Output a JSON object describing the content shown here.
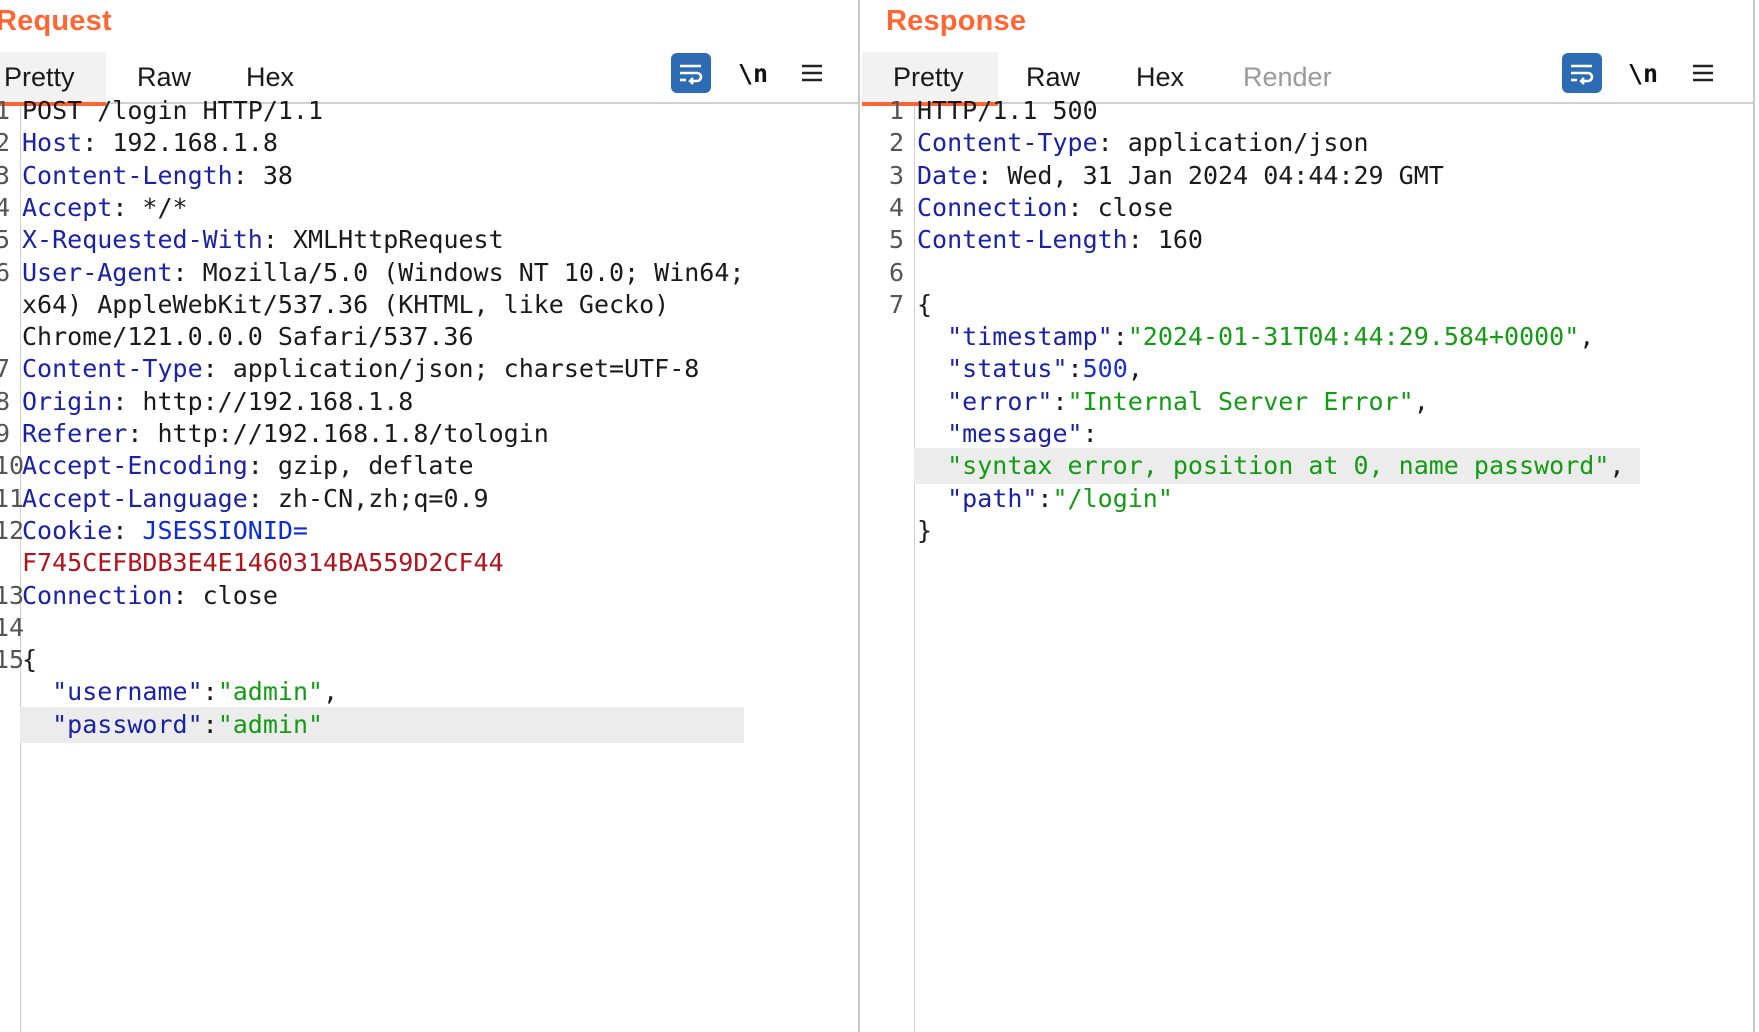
{
  "request": {
    "title": "Request",
    "tabs": [
      {
        "label": "Pretty",
        "active": true
      },
      {
        "label": "Raw",
        "active": false
      },
      {
        "label": "Hex",
        "active": false
      }
    ],
    "toolbar": {
      "wrap_icon": "word-wrap-icon",
      "newline_label": "\\n",
      "menu_icon": "hamburger-menu-icon"
    },
    "lines": [
      {
        "n": "1",
        "parts": [
          {
            "t": "POST /login HTTP/1.1",
            "c": "pl"
          }
        ]
      },
      {
        "n": "2",
        "parts": [
          {
            "t": "Host",
            "c": "hk"
          },
          {
            "t": ": 192.168.1.8",
            "c": "pl"
          }
        ]
      },
      {
        "n": "3",
        "parts": [
          {
            "t": "Content-Length",
            "c": "hk"
          },
          {
            "t": ": 38",
            "c": "pl"
          }
        ]
      },
      {
        "n": "4",
        "parts": [
          {
            "t": "Accept",
            "c": "hk"
          },
          {
            "t": ": */*",
            "c": "pl"
          }
        ]
      },
      {
        "n": "5",
        "parts": [
          {
            "t": "X-Requested-With",
            "c": "hk"
          },
          {
            "t": ": XMLHttpRequest",
            "c": "pl"
          }
        ]
      },
      {
        "n": "6",
        "parts": [
          {
            "t": "User-Agent",
            "c": "hk"
          },
          {
            "t": ": Mozilla/5.0 (Windows NT 10.0; Win64;",
            "c": "pl"
          }
        ]
      },
      {
        "n": "",
        "parts": [
          {
            "t": "x64) AppleWebKit/537.36 (KHTML, like Gecko)",
            "c": "pl"
          }
        ]
      },
      {
        "n": "",
        "parts": [
          {
            "t": "Chrome/121.0.0.0 Safari/537.36",
            "c": "pl"
          }
        ]
      },
      {
        "n": "7",
        "parts": [
          {
            "t": "Content-Type",
            "c": "hk"
          },
          {
            "t": ": application/json; charset=UTF-8",
            "c": "pl"
          }
        ]
      },
      {
        "n": "8",
        "parts": [
          {
            "t": "Origin",
            "c": "hk"
          },
          {
            "t": ": http://192.168.1.8",
            "c": "pl"
          }
        ]
      },
      {
        "n": "9",
        "parts": [
          {
            "t": "Referer",
            "c": "hk"
          },
          {
            "t": ": http://192.168.1.8/tologin",
            "c": "pl"
          }
        ]
      },
      {
        "n": "10",
        "parts": [
          {
            "t": "Accept-Encoding",
            "c": "hk"
          },
          {
            "t": ": gzip, deflate",
            "c": "pl"
          }
        ]
      },
      {
        "n": "11",
        "parts": [
          {
            "t": "Accept-Language",
            "c": "hk"
          },
          {
            "t": ": zh-CN,zh;q=0.9",
            "c": "pl"
          }
        ]
      },
      {
        "n": "12",
        "parts": [
          {
            "t": "Cookie",
            "c": "hk"
          },
          {
            "t": ": ",
            "c": "pl"
          },
          {
            "t": "JSESSIONID=",
            "c": "ck"
          }
        ]
      },
      {
        "n": "",
        "parts": [
          {
            "t": "F745CEFBDB3E4E1460314BA559D2CF44",
            "c": "cv"
          }
        ]
      },
      {
        "n": "13",
        "parts": [
          {
            "t": "Connection",
            "c": "hk"
          },
          {
            "t": ": close",
            "c": "pl"
          }
        ]
      },
      {
        "n": "14",
        "parts": []
      },
      {
        "n": "15",
        "parts": [
          {
            "t": "{",
            "c": "pl"
          }
        ]
      },
      {
        "n": "",
        "parts": [
          {
            "t": "  ",
            "c": "pl"
          },
          {
            "t": "\"username\"",
            "c": "key"
          },
          {
            "t": ":",
            "c": "pl"
          },
          {
            "t": "\"admin\"",
            "c": "str"
          },
          {
            "t": ",",
            "c": "pl"
          }
        ]
      },
      {
        "n": "",
        "highlight": true,
        "parts": [
          {
            "t": "  ",
            "c": "pl"
          },
          {
            "t": "\"password\"",
            "c": "key"
          },
          {
            "t": ":",
            "c": "pl"
          },
          {
            "t": "\"admin\"",
            "c": "str"
          }
        ]
      }
    ]
  },
  "response": {
    "title": "Response",
    "tabs": [
      {
        "label": "Pretty",
        "active": true
      },
      {
        "label": "Raw",
        "active": false
      },
      {
        "label": "Hex",
        "active": false
      },
      {
        "label": "Render",
        "active": false,
        "disabled": true
      }
    ],
    "toolbar": {
      "wrap_icon": "word-wrap-icon",
      "newline_label": "\\n",
      "menu_icon": "hamburger-menu-icon"
    },
    "lines": [
      {
        "n": "1",
        "parts": [
          {
            "t": "HTTP/1.1 500",
            "c": "pl"
          }
        ]
      },
      {
        "n": "2",
        "parts": [
          {
            "t": "Content-Type",
            "c": "hk"
          },
          {
            "t": ": application/json",
            "c": "pl"
          }
        ]
      },
      {
        "n": "3",
        "parts": [
          {
            "t": "Date",
            "c": "hk"
          },
          {
            "t": ": Wed, 31 Jan 2024 04:44:29 GMT",
            "c": "pl"
          }
        ]
      },
      {
        "n": "4",
        "parts": [
          {
            "t": "Connection",
            "c": "hk"
          },
          {
            "t": ": close",
            "c": "pl"
          }
        ]
      },
      {
        "n": "5",
        "parts": [
          {
            "t": "Content-Length",
            "c": "hk"
          },
          {
            "t": ": 160",
            "c": "pl"
          }
        ]
      },
      {
        "n": "6",
        "parts": []
      },
      {
        "n": "7",
        "parts": [
          {
            "t": "{",
            "c": "pl"
          }
        ]
      },
      {
        "n": "",
        "parts": [
          {
            "t": "  ",
            "c": "pl"
          },
          {
            "t": "\"timestamp\"",
            "c": "key"
          },
          {
            "t": ":",
            "c": "pl"
          },
          {
            "t": "\"2024-01-31T04:44:29.584+0000\"",
            "c": "str"
          },
          {
            "t": ",",
            "c": "pl"
          }
        ]
      },
      {
        "n": "",
        "parts": [
          {
            "t": "  ",
            "c": "pl"
          },
          {
            "t": "\"status\"",
            "c": "key"
          },
          {
            "t": ":",
            "c": "pl"
          },
          {
            "t": "500",
            "c": "num"
          },
          {
            "t": ",",
            "c": "pl"
          }
        ]
      },
      {
        "n": "",
        "parts": [
          {
            "t": "  ",
            "c": "pl"
          },
          {
            "t": "\"error\"",
            "c": "key"
          },
          {
            "t": ":",
            "c": "pl"
          },
          {
            "t": "\"Internal Server Error\"",
            "c": "str"
          },
          {
            "t": ",",
            "c": "pl"
          }
        ]
      },
      {
        "n": "",
        "parts": [
          {
            "t": "  ",
            "c": "pl"
          },
          {
            "t": "\"message\"",
            "c": "key"
          },
          {
            "t": ":",
            "c": "pl"
          }
        ]
      },
      {
        "n": "",
        "highlight": true,
        "parts": [
          {
            "t": "  ",
            "c": "pl"
          },
          {
            "t": "\"syntax error, position at 0, name password\"",
            "c": "str"
          },
          {
            "t": ",",
            "c": "pl"
          }
        ]
      },
      {
        "n": "",
        "parts": [
          {
            "t": "  ",
            "c": "pl"
          },
          {
            "t": "\"path\"",
            "c": "key"
          },
          {
            "t": ":",
            "c": "pl"
          },
          {
            "t": "\"/login\"",
            "c": "str"
          }
        ]
      },
      {
        "n": "",
        "parts": [
          {
            "t": "}",
            "c": "pl"
          }
        ]
      }
    ]
  },
  "layout_switch": {
    "buttons": [
      "split-horizontal-icon",
      "split-vertical-icon",
      "tabs-layout-icon"
    ],
    "active_index": 0
  },
  "colors": {
    "accent": "#ff6633",
    "header_key": "#1a22a6",
    "json_string": "#139b13",
    "json_number": "#1b2fd6",
    "cookie_value": "#b3141c",
    "button_blue": "#2d6bb4"
  }
}
